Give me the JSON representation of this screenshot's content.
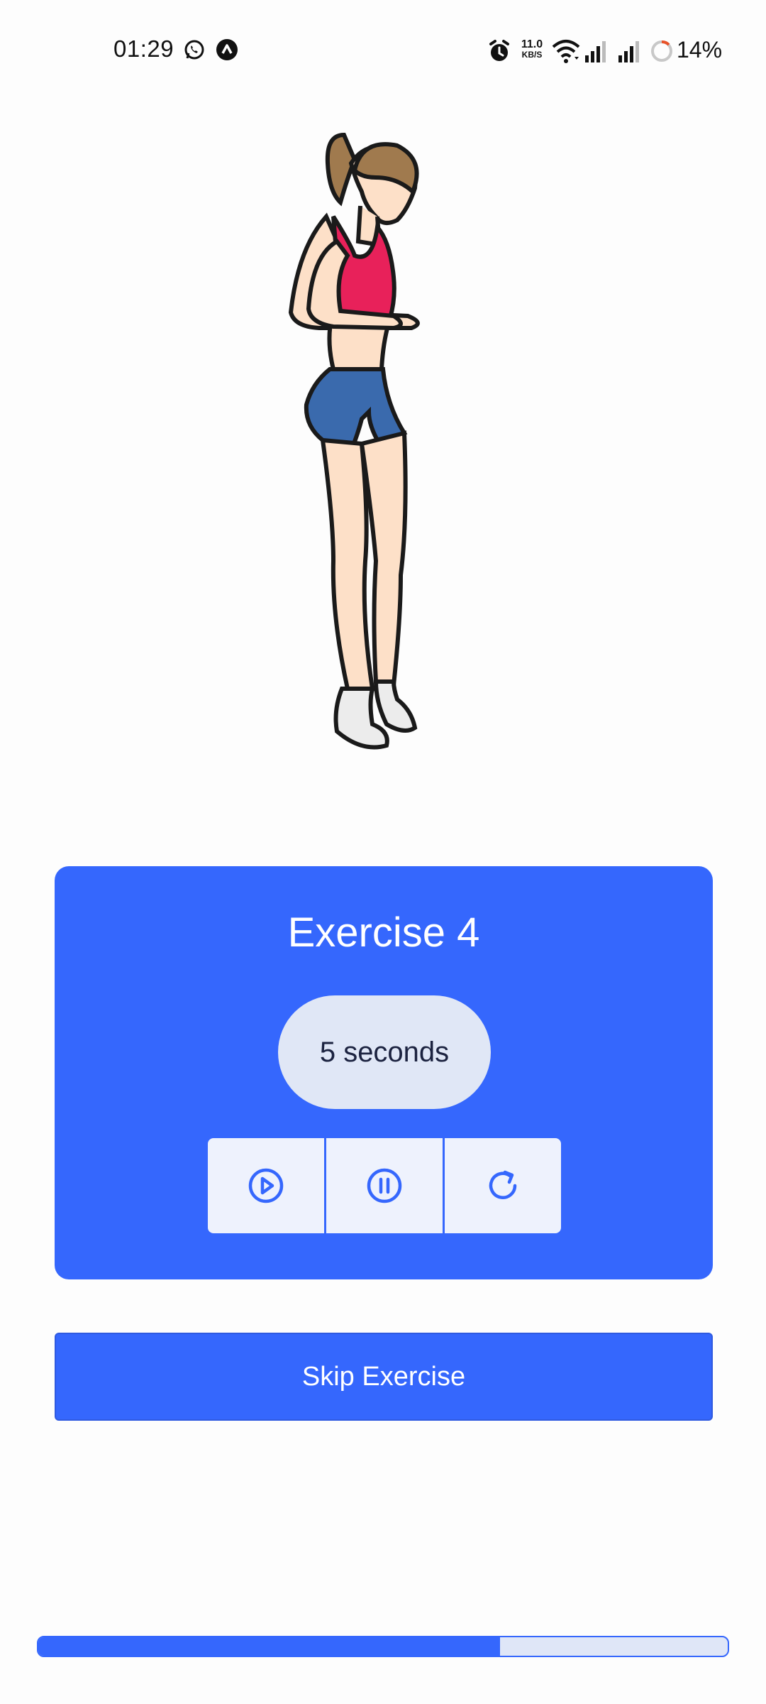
{
  "status_bar": {
    "time": "01:29",
    "net_speed_value": "11.0",
    "net_speed_unit": "KB/S",
    "battery": "14%",
    "icons": [
      "whatsapp-icon",
      "app-icon",
      "alarm-icon",
      "wifi-icon",
      "signal-icon",
      "signal-icon",
      "battery-ring-icon"
    ]
  },
  "illustration": {
    "subject": "woman-jumping-exercise"
  },
  "exercise": {
    "title": "Exercise 4",
    "timer": "5 seconds",
    "controls": [
      "play-icon",
      "pause-icon",
      "restart-icon"
    ]
  },
  "skip_label": "Skip Exercise",
  "progress": {
    "fraction": 0.67
  },
  "colors": {
    "accent": "#3567fd",
    "pill": "#e0e7f6",
    "control_bg": "#eef2fd",
    "track": "#dfe6f7"
  }
}
